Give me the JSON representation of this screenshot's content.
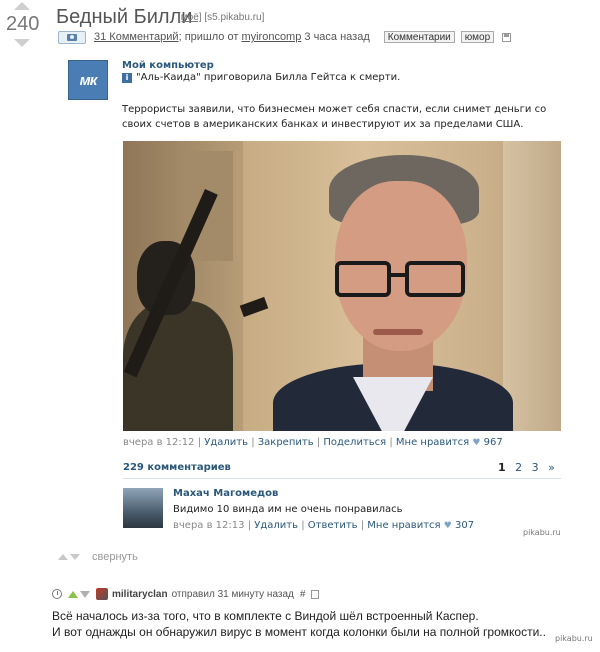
{
  "vote": {
    "score": "240"
  },
  "post": {
    "title": "Бедный Билли",
    "tag_mine": "[моё]",
    "tag_source": "[s5.pikabu.ru]",
    "comments_link": "31 Комментарий",
    "came_text": "; пришло от",
    "author": "myironcomp",
    "time_ago": "3 часа назад",
    "tags": [
      "Комментарии",
      "юмор"
    ]
  },
  "embed": {
    "group_name": "Мой компьютер",
    "logo_text": "мк",
    "headline": "\"Аль-Каида\" приговорила Билла Гейтса к смерти.",
    "body": "Террористы заявили, что бизнесмен может себя спасти, если снимет деньги со своих счетов в американских банках и инвестируют их за пределами США.",
    "post_time": "вчера в 12:12",
    "actions": [
      "Удалить",
      "Закрепить",
      "Поделиться"
    ],
    "like_label": "Мне нравится",
    "likes": "967",
    "comments_count": "229 комментариев",
    "pages": [
      "1",
      "2",
      "3",
      "»"
    ],
    "comment": {
      "author": "Махач Магомедов",
      "text": "Видимо 10 винда им не очень понравилась",
      "time": "вчера в 12:13",
      "actions": [
        "Удалить",
        "Ответить"
      ],
      "like_label": "Мне нравится",
      "likes": "307"
    },
    "watermark": "pikabu.ru"
  },
  "collapse_label": "свернуть",
  "comment": {
    "username": "militaryclan",
    "sent_text": "отправил 31 минуту назад",
    "hash": "#",
    "line1": "Всё началось из-за того, что в комплекте с Виндой шёл встроенный Каспер.",
    "line2": "И вот однажды он обнаружил вирус в момент когда колонки были на полной громкости..",
    "watermark": "pikabu.ru"
  },
  "colors": {
    "vk_blue": "#2b587a",
    "upvote_green": "#8bc34a"
  }
}
